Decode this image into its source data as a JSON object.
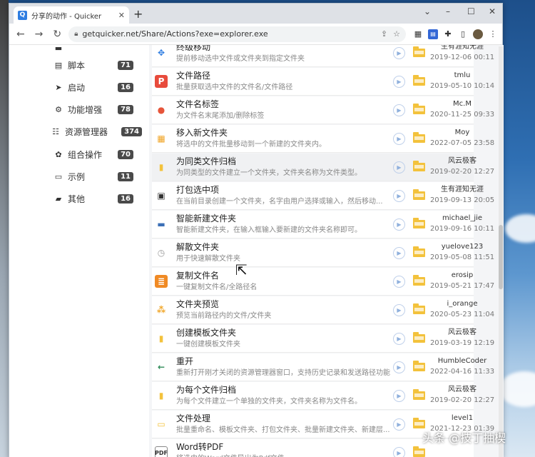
{
  "browser": {
    "tab_title": "分享的动作 - Quicker",
    "url": "getquicker.net/Share/Actions?exe=explorer.exe",
    "window_controls": [
      "⌄",
      "–",
      "☐",
      "✕"
    ]
  },
  "sidebar": {
    "items": [
      {
        "label": "脚本",
        "count": "71",
        "icon": "script-icon"
      },
      {
        "label": "启动",
        "count": "16",
        "icon": "launch-icon"
      },
      {
        "label": "功能增强",
        "count": "78",
        "icon": "enhance-icon"
      },
      {
        "label": "资源管理器",
        "count": "374",
        "icon": "explorer-icon"
      },
      {
        "label": "组合操作",
        "count": "70",
        "icon": "combo-icon"
      },
      {
        "label": "示例",
        "count": "11",
        "icon": "example-icon"
      },
      {
        "label": "其他",
        "count": "16",
        "icon": "other-icon"
      }
    ]
  },
  "actions": [
    {
      "title": "终级移动",
      "desc": "提前移动选中文件或文件夹到指定文件夹",
      "author": "生有涯知无涯",
      "date": "2019-12-06 00:11",
      "icon_char": "✥",
      "icon_color": "#2f7de1",
      "icon_bg": "transparent"
    },
    {
      "title": "文件路径",
      "desc": "批量获取选中文件的文件名/文件路径",
      "author": "tmlu",
      "date": "2019-05-10 10:14",
      "icon_char": "P",
      "icon_color": "#ffffff",
      "icon_bg": "#e84b3c"
    },
    {
      "title": "文件名标签",
      "desc": "为文件名末尾添加/删除标签",
      "author": "Mc.M",
      "date": "2020-11-25 09:33",
      "icon_char": "●",
      "icon_color": "#e6553a",
      "icon_bg": "transparent"
    },
    {
      "title": "移入新文件夹",
      "desc": "将选中的文件批量移动到一个新建的文件夹内。",
      "author": "Moy",
      "date": "2022-07-05 23:58",
      "icon_char": "▦",
      "icon_color": "#f0a424",
      "icon_bg": "transparent"
    },
    {
      "title": "为同类文件归档",
      "desc": "为同类型的文件建立一个文件夹，文件夹名称为文件类型。",
      "author": "风云极客",
      "date": "2019-02-20 12:27",
      "icon_char": "▮",
      "icon_color": "#f3c23c",
      "icon_bg": "transparent"
    },
    {
      "title": "打包选中项",
      "desc": "在当前目录创建一个文件夹，名字由用户选择或输入，然后移动...",
      "author": "生有涯知无涯",
      "date": "2019-09-13 20:05",
      "icon_char": "▣",
      "icon_color": "#333333",
      "icon_bg": "transparent"
    },
    {
      "title": "智能新建文件夹",
      "desc": "智能新建文件夹，在输入框输入要新建的文件夹名称即可。",
      "author": "michael_jie",
      "date": "2019-09-16 10:11",
      "icon_char": "▬",
      "icon_color": "#3b6fb6",
      "icon_bg": "transparent"
    },
    {
      "title": "解散文件夹",
      "desc": "用于快速解散文件夹",
      "author": "yuelove123",
      "date": "2019-05-08 11:51",
      "icon_char": "◷",
      "icon_color": "#9a9a9a",
      "icon_bg": "transparent"
    },
    {
      "title": "复制文件名",
      "desc": "一键复制文件名/全路径名",
      "author": "erosip",
      "date": "2019-05-21 17:47",
      "icon_char": "≣",
      "icon_color": "#ffffff",
      "icon_bg": "#f08a24"
    },
    {
      "title": "文件夹预览",
      "desc": "预览当前路径内的文件/文件夹",
      "author": "i_orange",
      "date": "2020-05-23 11:04",
      "icon_char": "⁂",
      "icon_color": "#f0a424",
      "icon_bg": "transparent"
    },
    {
      "title": "创建模板文件夹",
      "desc": "一键创建模板文件夹",
      "author": "风云极客",
      "date": "2019-03-19 12:19",
      "icon_char": "▮",
      "icon_color": "#f3c23c",
      "icon_bg": "transparent"
    },
    {
      "title": "重开",
      "desc": "重新打开刚才关闭的资源管理器窗口，支持历史记录和发送路径功能",
      "author": "HumbleCoder",
      "date": "2022-04-16 11:33",
      "icon_char": "←",
      "icon_color": "#2e8b57",
      "icon_bg": "transparent"
    },
    {
      "title": "为每个文件归档",
      "desc": "为每个文件建立一个单独的文件夹，文件夹名称为文件名。",
      "author": "风云极客",
      "date": "2019-02-20 12:27",
      "icon_char": "▮",
      "icon_color": "#f3c23c",
      "icon_bg": "transparent"
    },
    {
      "title": "文件处理",
      "desc": "批量重命名、模板文件夹、打包文件夹、批量新建文件夹、新建层...",
      "author": "level1",
      "date": "2021-12-23 01:39",
      "icon_char": "▭",
      "icon_color": "#f3c23c",
      "icon_bg": "transparent"
    },
    {
      "title": "Word转PDF",
      "desc": "将选中的Word文件导出为Pdf文件",
      "author": "",
      "date": "",
      "icon_char": "PDF",
      "icon_color": "#333333",
      "icon_bg": "transparent"
    }
  ],
  "watermark": "头条 @技丁抽楔"
}
